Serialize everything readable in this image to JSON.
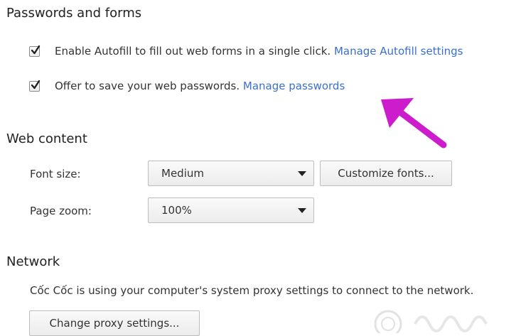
{
  "passwords_section": {
    "title": "Passwords and forms",
    "autofill": {
      "checked": true,
      "label": "Enable Autofill to fill out web forms in a single click.",
      "link": "Manage Autofill settings"
    },
    "save_passwords": {
      "checked": true,
      "label": "Offer to save your web passwords.",
      "link": "Manage passwords"
    }
  },
  "web_content_section": {
    "title": "Web content",
    "font_size": {
      "label": "Font size:",
      "value": "Medium",
      "button": "Customize fonts..."
    },
    "page_zoom": {
      "label": "Page zoom:",
      "value": "100%"
    }
  },
  "network_section": {
    "title": "Network",
    "description": "Cốc Cốc is using your computer's system proxy settings to connect to the network.",
    "button": "Change proxy settings..."
  },
  "annotation": {
    "arrow_color": "#cc1ccc",
    "points_to": "manage-passwords-link"
  }
}
